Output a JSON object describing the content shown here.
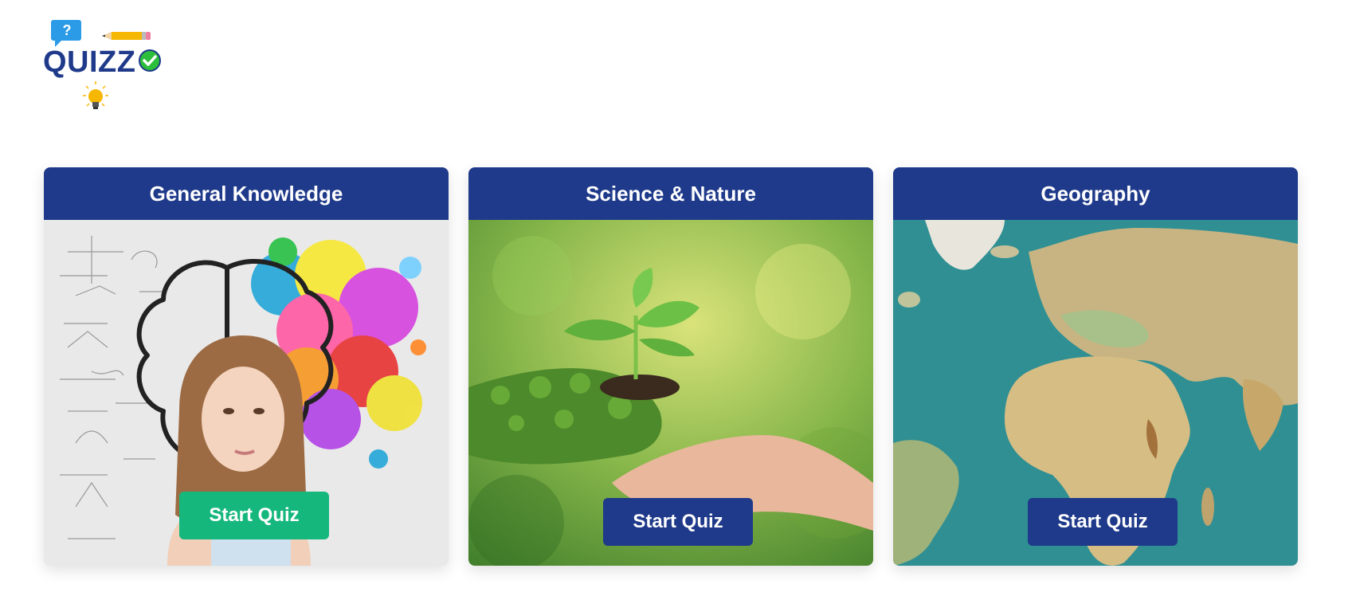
{
  "logo": {
    "text": "QUIZZ",
    "question_mark": "?"
  },
  "quizzes": [
    {
      "title": "General Knowledge",
      "button_label": "Start Quiz"
    },
    {
      "title": "Science & Nature",
      "button_label": "Start Quiz"
    },
    {
      "title": "Geography",
      "button_label": "Start Quiz"
    }
  ],
  "colors": {
    "brand_navy": "#1f3a8a",
    "accent_green": "#16b77d"
  },
  "icons": [
    "speech-bubble-icon",
    "pencil-icon",
    "checkmark-icon",
    "lightbulb-icon"
  ]
}
